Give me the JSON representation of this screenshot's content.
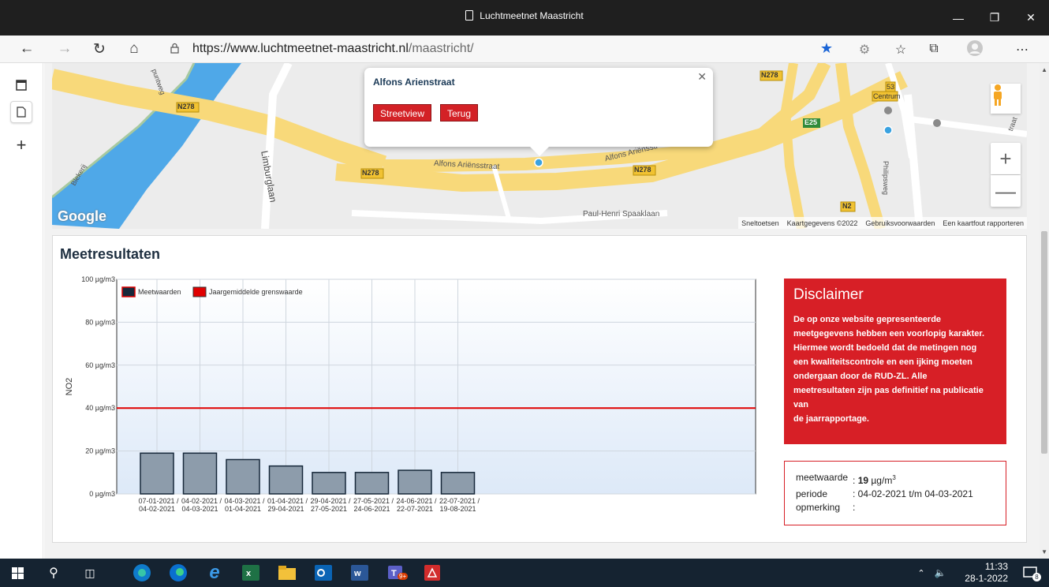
{
  "window": {
    "title": "Luchtmeetnet Maastricht"
  },
  "browser": {
    "url_host": "https://www.luchtmeetnet-maastricht.nl",
    "url_path": "/maastricht/"
  },
  "map": {
    "popup": {
      "title": "Alfons Arienstraat",
      "streetview_label": "Streetview",
      "back_label": "Terug"
    },
    "labels": {
      "n278": "N278",
      "puntweg": "puntweg",
      "limburglaan": "Limburglaan",
      "alfons1": "Alfons Ariënsstraat",
      "alfons2": "Alfons Ariënsstr",
      "spaaklaan": "Paul-Henri Spaaklaan",
      "centrum": "Centrum",
      "e25": "E25",
      "n2": "N2",
      "philipsweg": "Philipsweg",
      "bleijerij": "Blekerij",
      "n53": "53",
      "traat": "traat"
    },
    "google_logo": "Google",
    "footer": [
      "Sneltoetsen",
      "Kaartgegevens ©2022",
      "Gebruiksvoorwaarden",
      "Een kaartfout rapporteren"
    ]
  },
  "results": {
    "title": "Meetresultaten"
  },
  "chart_data": {
    "type": "bar",
    "ylabel": "NO2",
    "ylim": [
      0,
      100
    ],
    "yticks": [
      "0 µg/m3",
      "20 µg/m3",
      "40 µg/m3",
      "60 µg/m3",
      "80 µg/m3",
      "100 µg/m3"
    ],
    "categories": [
      [
        "07-01-2021 /",
        "04-02-2021"
      ],
      [
        "04-02-2021 /",
        "04-03-2021"
      ],
      [
        "04-03-2021 /",
        "01-04-2021"
      ],
      [
        "01-04-2021 /",
        "29-04-2021"
      ],
      [
        "29-04-2021 /",
        "27-05-2021"
      ],
      [
        "27-05-2021 /",
        "24-06-2021"
      ],
      [
        "24-06-2021 /",
        "22-07-2021"
      ],
      [
        "22-07-2021 /",
        "19-08-2021"
      ]
    ],
    "series": [
      {
        "name": "Meetwaarden",
        "values": [
          19,
          19,
          16,
          13,
          10,
          10,
          11,
          10
        ],
        "color": "#8d9cab"
      },
      {
        "name": "Jaargemiddelde grenswaarde",
        "values": [
          40
        ],
        "color": "#e00000"
      }
    ],
    "legend": "top-left",
    "grid": true
  },
  "disclaimer": {
    "title": "Disclaimer",
    "lines": [
      "De op onze website gepresenteerde",
      "meetgegevens hebben een voorlopig karakter.",
      "Hiermee wordt bedoeld dat de metingen nog",
      "een kwaliteitscontrole en een ijking moeten",
      "ondergaan door de RUD-ZL. Alle",
      "meetresultaten zijn pas definitief na publicatie",
      "van",
      "de jaarrapportage."
    ]
  },
  "info": {
    "meetwaarde_label": "meetwaarde",
    "meetwaarde_sep": ":",
    "meetwaarde_value": "19",
    "meetwaarde_unit": "µg/m",
    "meetwaarde_sup": "3",
    "periode_label": "periode",
    "periode_value": ": 04-02-2021 t/m 04-03-2021",
    "opmerking_label": "opmerking",
    "opmerking_value": ":"
  },
  "taskbar": {
    "time": "11:33",
    "date": "28-1-2022",
    "notification_count": "8",
    "teams_badge": "9+"
  },
  "colors": {
    "accent_red": "#d71f26",
    "titlebar": "#1f1f1f",
    "taskbar": "#152331",
    "bar_fill": "#8d9cab",
    "bar_stroke": "#17283a"
  }
}
